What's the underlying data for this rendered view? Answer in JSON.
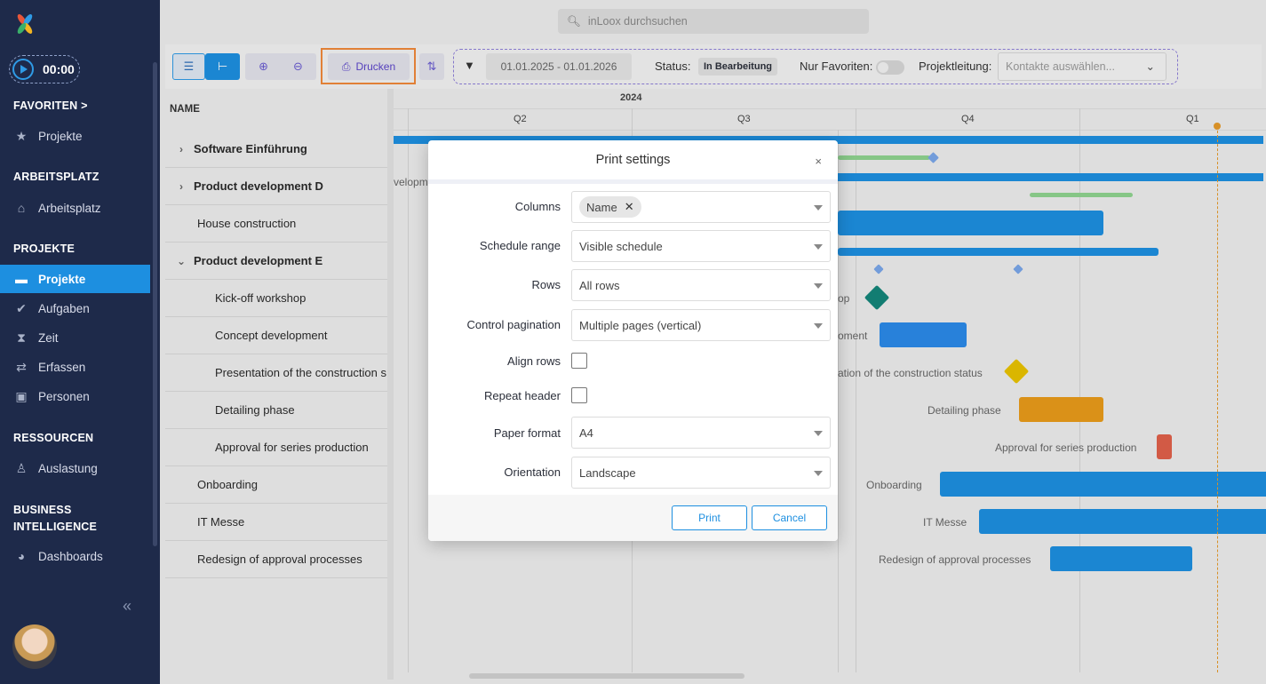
{
  "timer": "00:00",
  "sidebar": {
    "favorites_title": "FAVORITEN",
    "favorites_items": [
      "Projekte"
    ],
    "workspace_title": "ARBEITSPLATZ",
    "workspace_items": [
      "Arbeitsplatz"
    ],
    "projects_title": "PROJEKTE",
    "projects_items": [
      "Projekte",
      "Aufgaben",
      "Zeit",
      "Erfassen",
      "Personen"
    ],
    "resources_title": "RESSOURCEN",
    "resources_items": [
      "Auslastung"
    ],
    "bi_title_1": "BUSINESS",
    "bi_title_2": "INTELLIGENCE",
    "bi_items": [
      "Dashboards"
    ],
    "collapse": "«"
  },
  "search": {
    "placeholder": "inLoox durchsuchen"
  },
  "toolbar": {
    "print_label": "Drucken",
    "date_range": "01.01.2025 - 01.01.2026",
    "status_label": "Status:",
    "status_value": "In Bearbeitung",
    "favorites_only_label": "Nur Favoriten:",
    "lead_label": "Projektleitung:",
    "lead_placeholder": "Kontakte auswählen..."
  },
  "grid": {
    "name_header": "NAME",
    "year": "2024",
    "quarters": [
      "Q2",
      "Q3",
      "Q4",
      "Q1"
    ],
    "rows": [
      "Software Einführung",
      "Product development D",
      "House construction",
      "Product development E",
      "Kick-off workshop",
      "Concept development",
      "Presentation of the construction s",
      "Detailing phase",
      "Approval for series production",
      "Onboarding",
      "IT Messe",
      "Redesign of approval processes"
    ],
    "bar_labels": {
      "dev": "velopm",
      "kickoff": "op",
      "concept": "oment",
      "presentation": "ation of the construction status",
      "detailing": "Detailing phase",
      "approval": "Approval for series production",
      "onboarding": "Onboarding",
      "itmesse": "IT Messe",
      "redesign": "Redesign of approval processes"
    }
  },
  "modal": {
    "title": "Print settings",
    "close": "×",
    "columns_label": "Columns",
    "columns_chip": "Name",
    "schedule_label": "Schedule range",
    "schedule_value": "Visible schedule",
    "rows_label": "Rows",
    "rows_value": "All rows",
    "pagination_label": "Control pagination",
    "pagination_value": "Multiple pages (vertical)",
    "align_rows_label": "Align rows",
    "repeat_header_label": "Repeat header",
    "paper_label": "Paper format",
    "paper_value": "A4",
    "orientation_label": "Orientation",
    "orientation_value": "Landscape",
    "print_button": "Print",
    "cancel_button": "Cancel"
  },
  "colors": {
    "sidebar_bg": "#1e2a4a",
    "accent_blue": "#1d8fe0",
    "highlight_orange": "#f0883a",
    "milestone_teal": "#14857a",
    "milestone_yellow": "#e8c200",
    "bar_orange": "#e89b1a",
    "bar_red": "#e0604a",
    "bar_green": "#8fd38f"
  }
}
